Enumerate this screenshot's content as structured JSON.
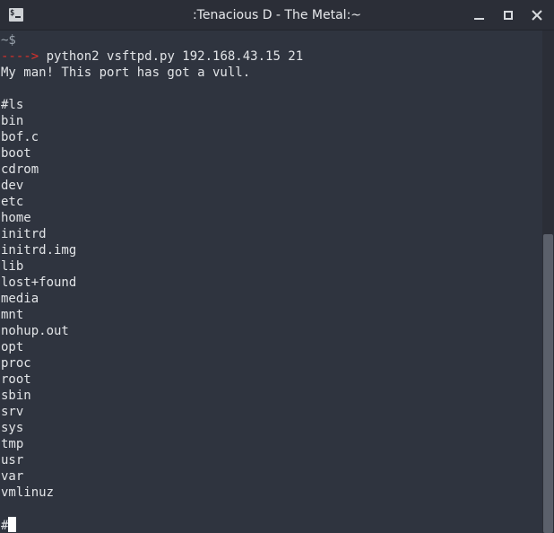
{
  "window": {
    "title": ":Tenacious D - The Metal:~",
    "icon_text": "$"
  },
  "terminal": {
    "prompt": "~$",
    "arrow": "---->",
    "command": " python2 vsftpd.py 192.168.43.15 21",
    "output": "My man! This port has got a vull.",
    "ls_command": "#ls",
    "listing": [
      "bin",
      "bof.c",
      "boot",
      "cdrom",
      "dev",
      "etc",
      "home",
      "initrd",
      "initrd.img",
      "lib",
      "lost+found",
      "media",
      "mnt",
      "nohup.out",
      "opt",
      "proc",
      "root",
      "sbin",
      "srv",
      "sys",
      "tmp",
      "usr",
      "var",
      "vmlinuz"
    ],
    "final_prompt": "#"
  },
  "colors": {
    "background": "#2f343f",
    "titlebar": "#2b2e37",
    "text": "#e2e4e7",
    "arrow": "#e0302a",
    "scroll_thumb": "#5b606b"
  },
  "icons": {
    "app": "terminal-icon",
    "minimize": "minimize-icon",
    "maximize": "maximize-icon",
    "close": "close-icon"
  }
}
